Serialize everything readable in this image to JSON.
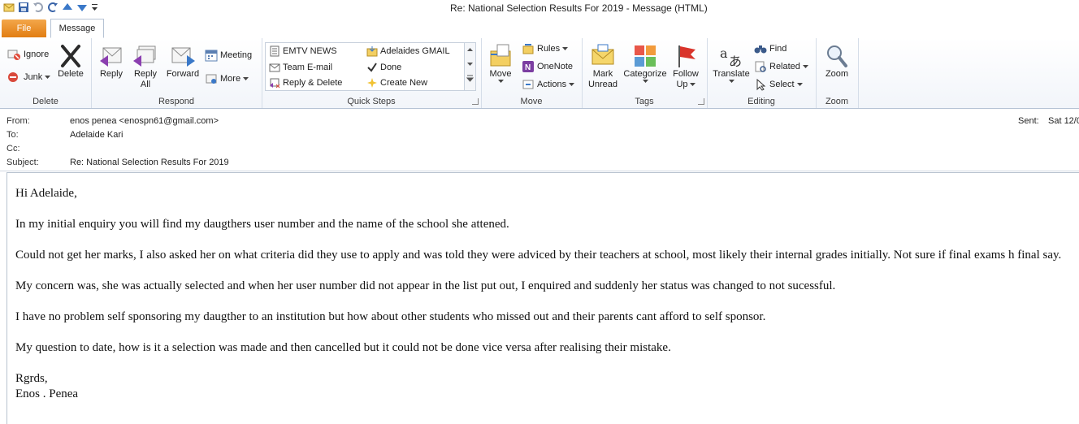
{
  "window": {
    "title": "Re: National Selection Results For 2019  -  Message (HTML)"
  },
  "qat": {
    "icons": [
      "envelope-icon",
      "save-icon",
      "undo-icon",
      "redo-icon",
      "up-arrow-icon",
      "down-arrow-icon",
      "customize-icon"
    ]
  },
  "tabs": {
    "file": "File",
    "message": "Message"
  },
  "ribbon": {
    "delete_group": {
      "label": "Delete",
      "ignore": "Ignore",
      "junk": "Junk",
      "delete": "Delete"
    },
    "respond_group": {
      "label": "Respond",
      "reply": "Reply",
      "reply_all_1": "Reply",
      "reply_all_2": "All",
      "forward": "Forward",
      "meeting": "Meeting",
      "more": "More"
    },
    "quick_steps_group": {
      "label": "Quick Steps",
      "items": [
        "EMTV NEWS",
        "Adelaides GMAIL",
        "Team E-mail",
        "Done",
        "Reply & Delete",
        "Create New"
      ]
    },
    "move_group": {
      "label": "Move",
      "move": "Move",
      "rules": "Rules",
      "onenote": "OneNote",
      "actions": "Actions"
    },
    "tags_group": {
      "label": "Tags",
      "mark_unread_1": "Mark",
      "mark_unread_2": "Unread",
      "categorize": "Categorize",
      "follow_up_1": "Follow",
      "follow_up_2": "Up"
    },
    "editing_group": {
      "label": "Editing",
      "translate": "Translate",
      "find": "Find",
      "related": "Related",
      "select": "Select"
    },
    "zoom_group": {
      "label": "Zoom",
      "zoom": "Zoom"
    }
  },
  "headers": {
    "from_label": "From:",
    "from_value": "enos penea <enospn61@gmail.com>",
    "to_label": "To:",
    "to_value": "Adelaide Kari",
    "cc_label": "Cc:",
    "cc_value": "",
    "subject_label": "Subject:",
    "subject_value": "Re: National Selection Results For 2019",
    "sent_label": "Sent:",
    "sent_value": "Sat 12/0"
  },
  "message": {
    "greeting": "Hi Adelaide,",
    "p1": "In my initial enquiry you will find my daugthers user number and the name of the school she attened.",
    "p2": "Could not get her marks, I also asked her on what criteria did they use to apply and was told they were adviced by their teachers at school, most likely their internal grades initially. Not sure if final exams h final say.",
    "p3": "My concern was, she was actually selected and when her user number did not appear in the list put out, I enquired and suddenly her status was changed to not sucessful.",
    "p4": "I have no problem self sponsoring my daugther to an institution but how about other students who missed out and their parents cant afford to self sponsor.",
    "p5": "My question to date, how is it a selection was made and then cancelled but it could not be done vice versa after realising their mistake.",
    "closing": "Rgrds,",
    "signature": "Enos . Penea"
  }
}
